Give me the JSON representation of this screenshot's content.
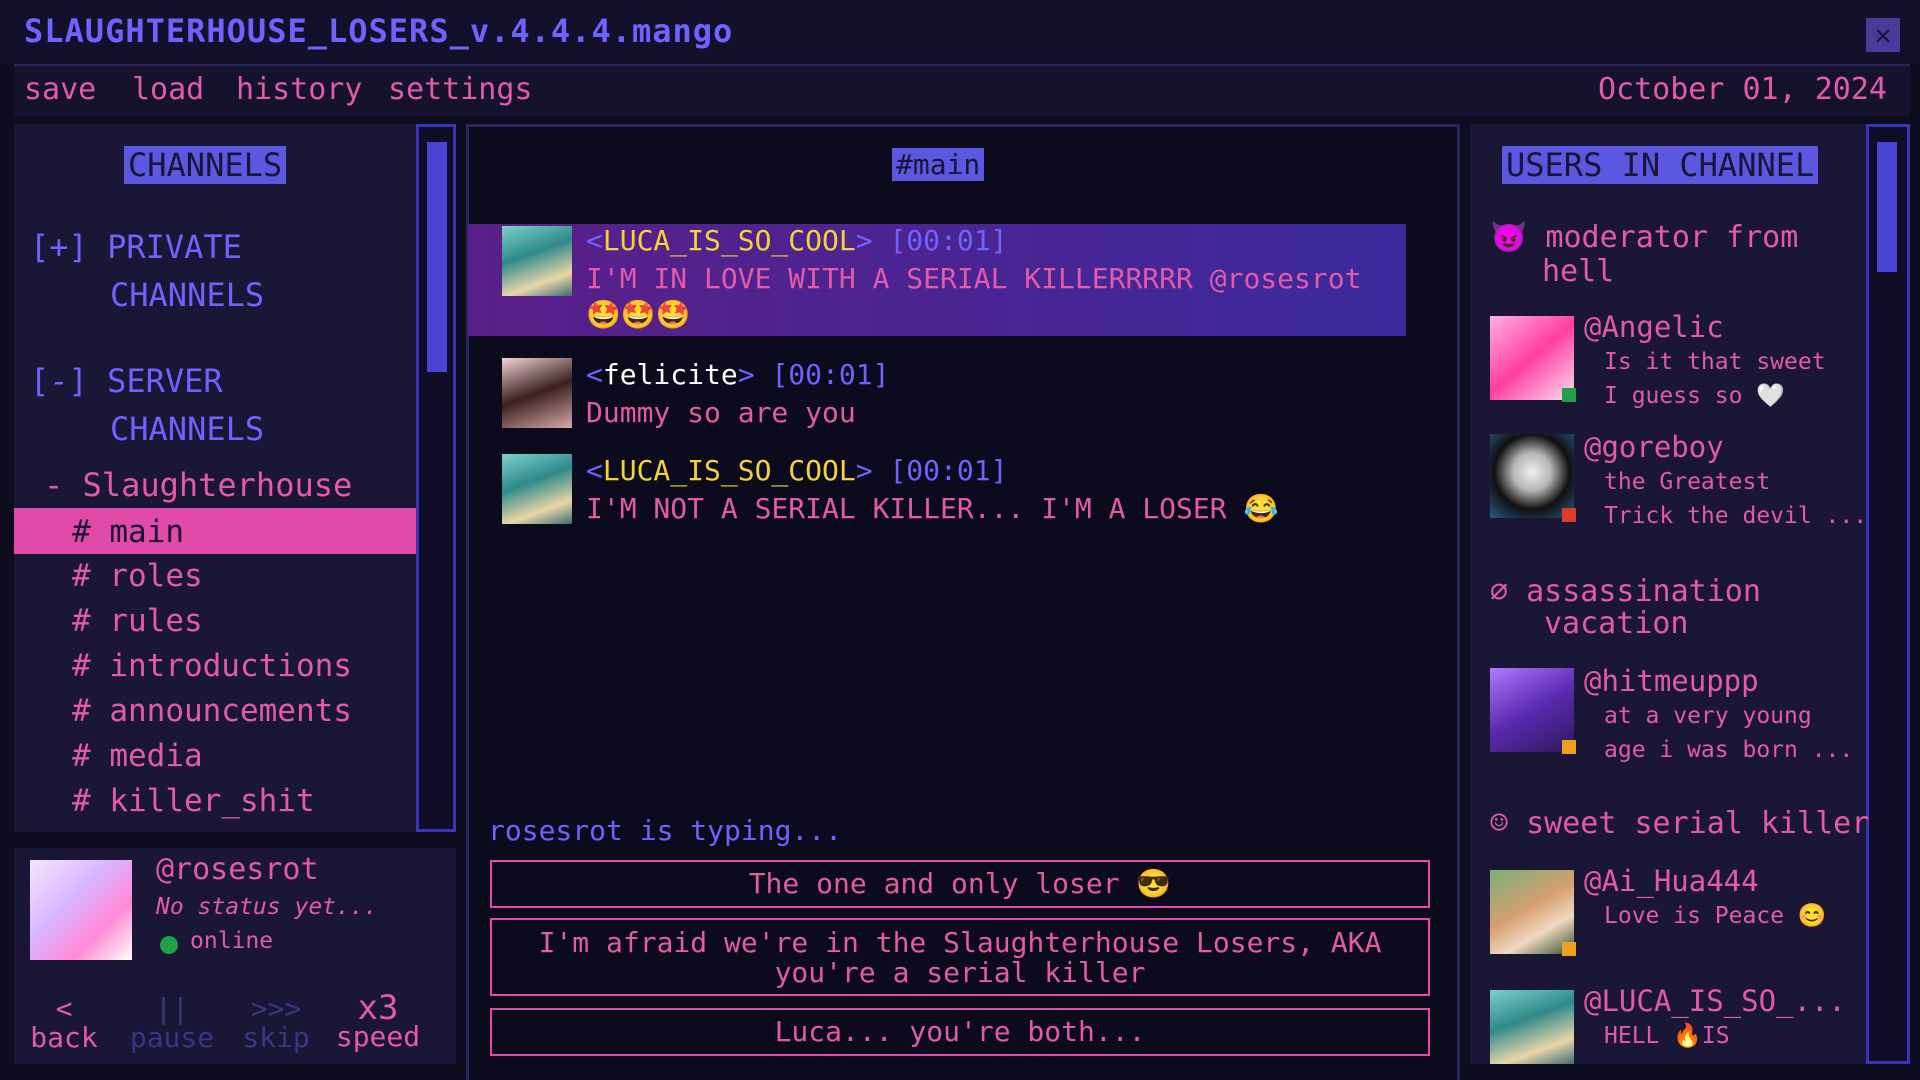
{
  "app": {
    "title": "SLAUGHTERHOUSE_LOSERS_v.4.4.4.mango"
  },
  "menu": {
    "save": "save",
    "load": "load",
    "history": "history",
    "settings": "settings",
    "date": "October 01, 2024"
  },
  "channels": {
    "header": "CHANNELS",
    "private_toggle": "[+]",
    "private_label_1": "PRIVATE",
    "private_label_2": "CHANNELS",
    "server_toggle": "[-]",
    "server_label_1": "SERVER",
    "server_label_2": "CHANNELS",
    "server_name": "- Slaughterhouse",
    "items": [
      {
        "label": "# main"
      },
      {
        "label": "# roles"
      },
      {
        "label": "# rules"
      },
      {
        "label": "# introductions"
      },
      {
        "label": "# announcements"
      },
      {
        "label": "# media"
      },
      {
        "label": "# killer_shit"
      }
    ]
  },
  "self_user": {
    "handle": "@rosesrot",
    "status": "No status yet...",
    "presence": "online"
  },
  "controls": {
    "back_icon": "<",
    "back": "back",
    "pause_icon": "||",
    "pause": "pause",
    "skip_icon": ">>>",
    "skip": "skip",
    "speed_icon": "x3",
    "speed": "speed"
  },
  "chat": {
    "channel_tab": "#main",
    "messages": [
      {
        "name": "LUCA_IS_SO_COOL",
        "time": "[00:01]",
        "text": "I'M IN LOVE WITH A SERIAL KILLERRRRR @rosesrot",
        "text2": "🤩🤩🤩"
      },
      {
        "name": "felicite",
        "time": "[00:01]",
        "text": "Dummy so are you"
      },
      {
        "name": "LUCA_IS_SO_COOL",
        "time": "[00:01]",
        "text": "I'M NOT A SERIAL KILLER... I'M A LOSER 😂"
      }
    ],
    "typing": "rosesrot is typing...",
    "choices": [
      {
        "line1": "The one and only loser 😎"
      },
      {
        "line1": "I'm afraid we're in the Slaughterhouse Losers, AKA",
        "line2": "you're a serial killer"
      },
      {
        "line1": "Luca... you're both..."
      }
    ]
  },
  "users_panel": {
    "header": "USERS IN CHANNEL",
    "groups": [
      {
        "icon": "😈",
        "title_1": "moderator from",
        "title_2": "hell",
        "users": [
          {
            "name": "@Angelic",
            "s1": "Is it that sweet",
            "s2": "I guess so 🤍",
            "dot": "#1fa04a"
          },
          {
            "name": "@goreboy",
            "s1": "the Greatest",
            "s2": "Trick the devil ...",
            "dot": "#e03a2a"
          }
        ]
      },
      {
        "icon": "∅",
        "title_1": "assassination",
        "title_2": "vacation",
        "users": [
          {
            "name": "@hitmeuppp",
            "s1": "at a very young",
            "s2": "age i was born ...",
            "dot": "#f0a020"
          }
        ]
      },
      {
        "icon": "☺",
        "title_1": "sweet serial killer",
        "users": [
          {
            "name": "@Ai_Hua444",
            "s1": "Love is Peace 😊",
            "dot": "#f0a020"
          },
          {
            "name": "@LUCA_IS_SO_...",
            "s1": "HELL 🔥IS"
          }
        ]
      }
    ]
  },
  "colors": {
    "accent": "#6f62ff",
    "pink": "#e25aa8",
    "highlight": "#e04aa8",
    "background": "#0e0c1f"
  }
}
